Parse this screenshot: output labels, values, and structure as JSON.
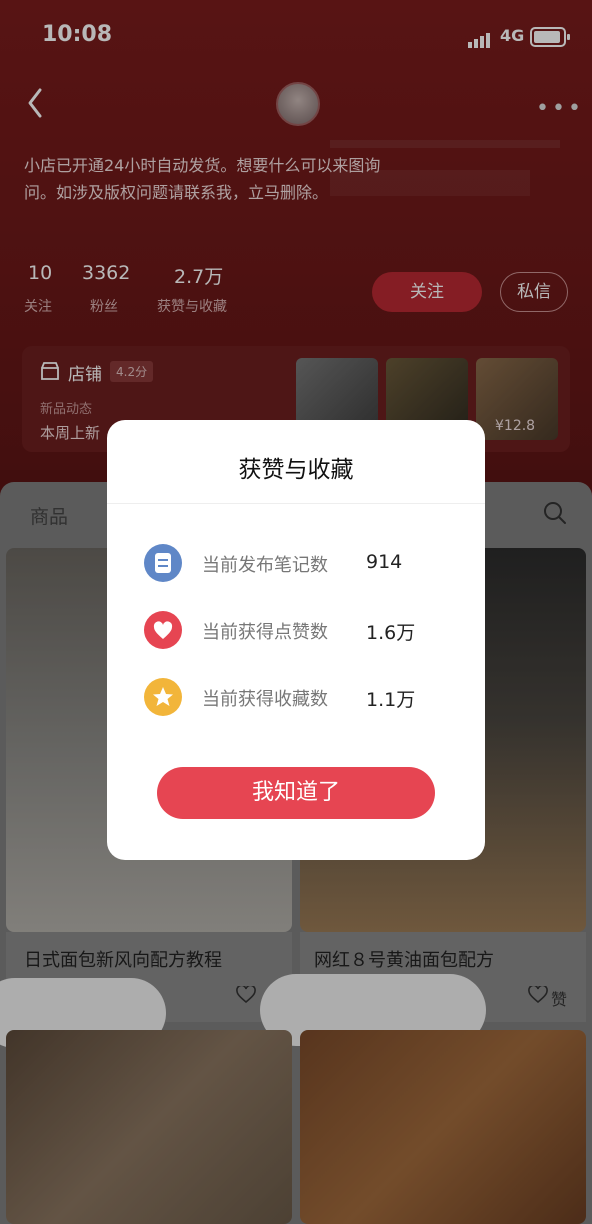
{
  "status_bar": {
    "time": "10:08",
    "network": "4G"
  },
  "header": {
    "bio": "小店已开通24小时自动发货。想要什么可以来图询问。如涉及版权问题请联系我，立马删除。",
    "stats": [
      {
        "value": "10",
        "label": "关注"
      },
      {
        "value": "3362",
        "label": "粉丝"
      },
      {
        "value": "2.7万",
        "label": "获赞与收藏"
      }
    ],
    "follow_label": "关注",
    "dm_label": "私信"
  },
  "shop": {
    "name": "店铺",
    "rating": "4.2分",
    "new_label": "新品动态",
    "new_text": "本周上新",
    "price": "¥12.8"
  },
  "feed": {
    "tab": "商品",
    "cards": [
      {
        "title": "日式面包新风向配方教程",
        "like_label": "赞"
      },
      {
        "title": "网红８号黄油面包配方",
        "like_label": "赞"
      }
    ]
  },
  "modal": {
    "title": "获赞与收藏",
    "rows": [
      {
        "icon": "note-icon",
        "label": "当前发布笔记数",
        "value": "914",
        "color": "#5f87c7"
      },
      {
        "icon": "heart-icon",
        "label": "当前获得点赞数",
        "value": "1.6万",
        "color": "#e64552"
      },
      {
        "icon": "star-icon",
        "label": "当前获得收藏数",
        "value": "1.1万",
        "color": "#f2b53a"
      }
    ],
    "confirm_label": "我知道了"
  }
}
